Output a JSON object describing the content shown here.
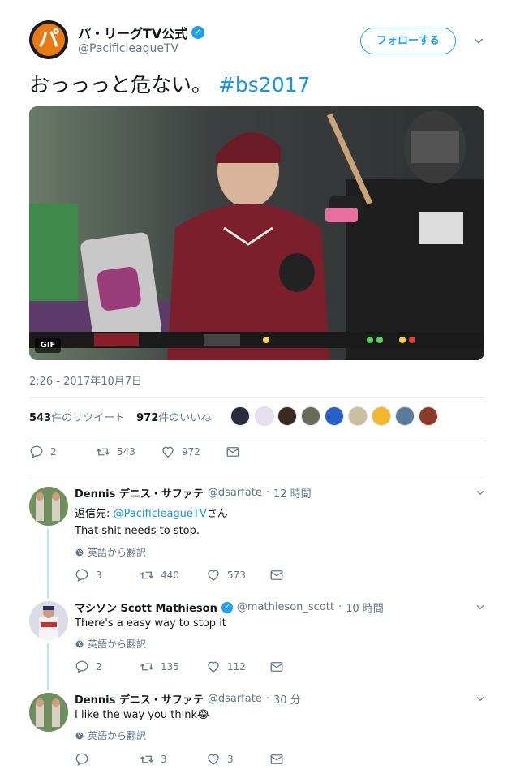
{
  "tweet": {
    "account_name": "パ・リーグTV公式",
    "handle": "@PacificleagueTV",
    "avatar_text": "パ",
    "follow_label": "フォローする",
    "text": "おっっっと危ない。",
    "hashtag": "#bs2017",
    "media_badge": "GIF",
    "timestamp": "2:26 - 2017年10月7日",
    "retweets_count": "543",
    "retweets_label": "件のリツイート",
    "likes_count": "972",
    "likes_label": "件のいいね",
    "actions": {
      "reply": "2",
      "retweet": "543",
      "like": "972"
    }
  },
  "replies": [
    {
      "name": "Dennis デニス・サファテ",
      "handle": "@dsarfate",
      "time": "12 時間",
      "reply_to_prefix": "返信先:",
      "reply_to_handle": "@PacificleagueTV",
      "reply_to_suffix": "さん",
      "text": "That shit needs to stop.",
      "translate": "英語から翻訳",
      "actions": {
        "reply": "3",
        "retweet": "440",
        "like": "573"
      }
    },
    {
      "name": "マシソン Scott Mathieson",
      "handle": "@mathieson_scott",
      "time": "10 時間",
      "text": "There's a easy way to stop it",
      "translate": "英語から翻訳",
      "actions": {
        "reply": "2",
        "retweet": "135",
        "like": "112"
      }
    },
    {
      "name": "Dennis デニス・サファテ",
      "handle": "@dsarfate",
      "time": "30 分",
      "text": "I like the way you think😂",
      "translate": "英語から翻訳",
      "actions": {
        "reply": "",
        "retweet": "3",
        "like": "3"
      }
    }
  ],
  "colors": {
    "accent": "#1da1f2",
    "link": "#1b95e0",
    "muted": "#657786",
    "thread_line": "#bfe3e8",
    "team_maroon": "#7a1f2b"
  }
}
